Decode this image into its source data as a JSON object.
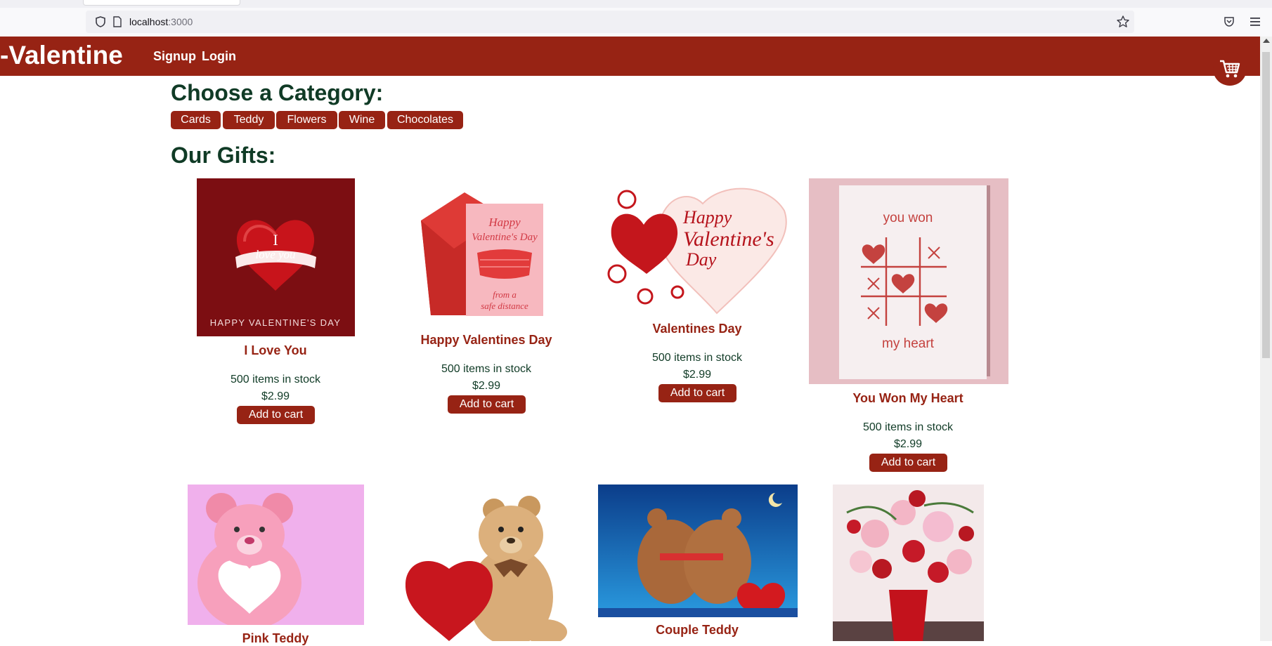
{
  "browser": {
    "url_host": "localhost",
    "url_port": ":3000"
  },
  "navbar": {
    "brand": "-Valentine",
    "links": [
      "Signup",
      "Login"
    ]
  },
  "categories": {
    "heading": "Choose a Category:",
    "items": [
      "Cards",
      "Teddy",
      "Flowers",
      "Wine",
      "Chocolates"
    ]
  },
  "gifts": {
    "heading": "Our Gifts:",
    "add_label": "Add to cart",
    "products": [
      {
        "name": "I Love You",
        "stock": "500 items in stock",
        "price": "$2.99",
        "image_text": [
          "I",
          "love you",
          "HAPPY VALENTINE'S DAY"
        ]
      },
      {
        "name": "Happy Valentines Day",
        "stock": "500 items in stock",
        "price": "$2.99",
        "image_text": [
          "Happy",
          "Valentine's Day",
          "from a",
          "safe distance"
        ]
      },
      {
        "name": "Valentines Day",
        "stock": "500 items in stock",
        "price": "$2.99",
        "image_text": [
          "Happy",
          "Valentine's",
          "Day"
        ]
      },
      {
        "name": "You Won My Heart",
        "stock": "500 items in stock",
        "price": "$2.99",
        "image_text": [
          "you won",
          "my heart"
        ]
      },
      {
        "name": "Pink Teddy"
      },
      {
        "name": ""
      },
      {
        "name": "Couple Teddy"
      },
      {
        "name": ""
      }
    ]
  },
  "colors": {
    "brand": "#972314",
    "heading": "#103b26"
  }
}
